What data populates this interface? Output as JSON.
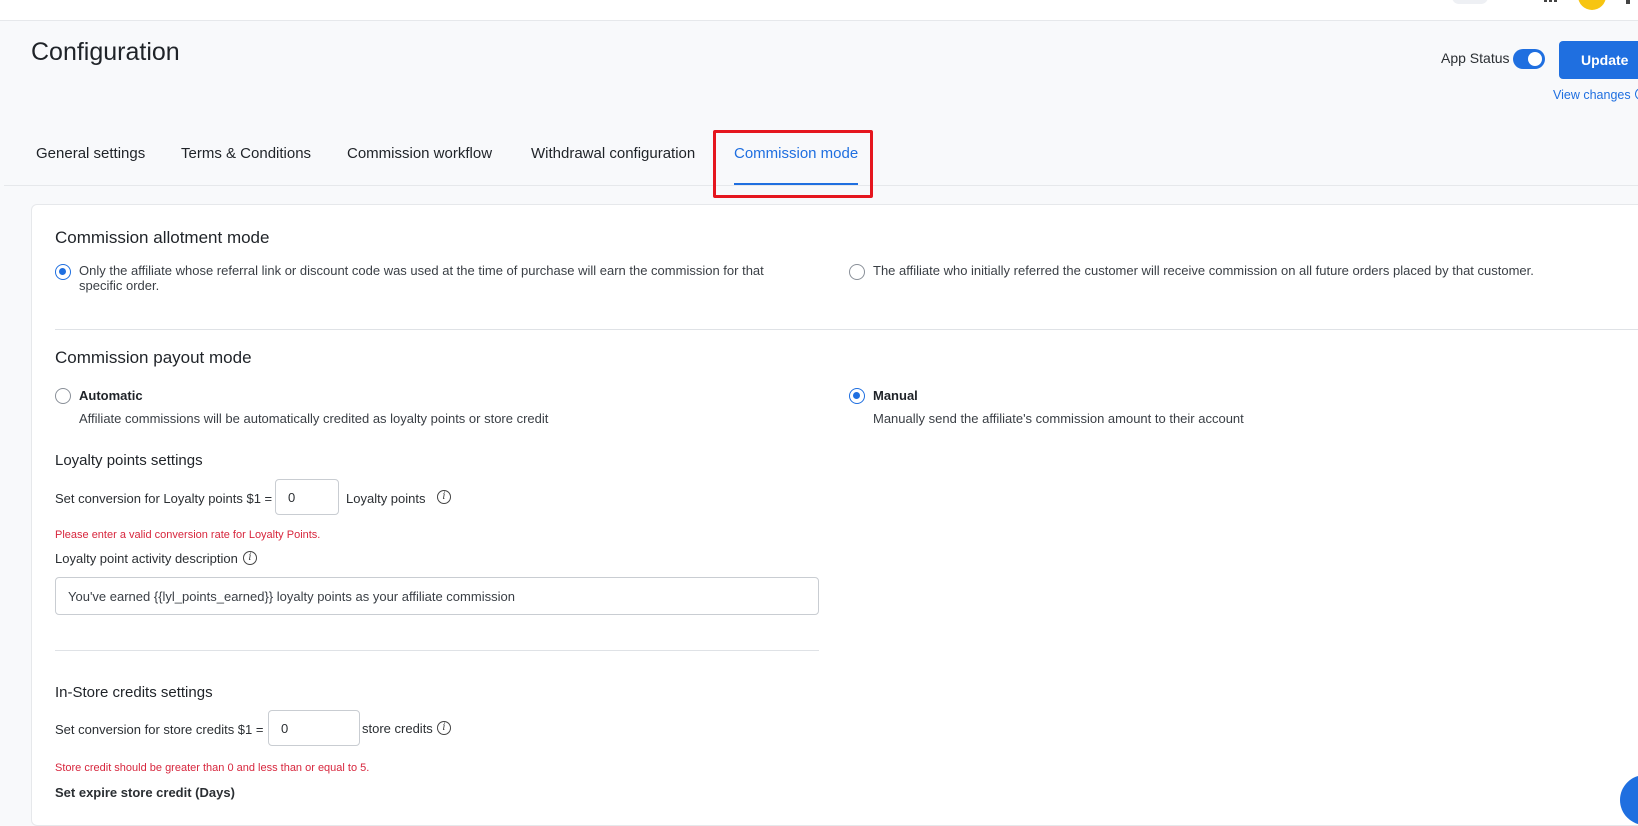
{
  "header": {
    "page_title": "Configuration",
    "app_status_label": "App Status",
    "app_status_on": true,
    "update_label": "Update",
    "view_changes_label": "View changes"
  },
  "tabs": [
    {
      "label": "General settings",
      "active": false
    },
    {
      "label": "Terms & Conditions",
      "active": false
    },
    {
      "label": "Commission workflow",
      "active": false
    },
    {
      "label": "Withdrawal configuration",
      "active": false
    },
    {
      "label": "Commission mode",
      "active": true
    }
  ],
  "allotment": {
    "title": "Commission allotment mode",
    "options": [
      {
        "text": "Only the affiliate whose referral link or discount code was used at the time of purchase will earn the commission for that specific order.",
        "checked": true
      },
      {
        "text": "The affiliate who initially referred the customer will receive commission on all future orders placed by that customer.",
        "checked": false
      }
    ]
  },
  "payout": {
    "title": "Commission payout mode",
    "options": [
      {
        "label": "Automatic",
        "description": "Affiliate commissions will be automatically credited as loyalty points or store credit",
        "checked": false
      },
      {
        "label": "Manual",
        "description": "Manually send the affiliate's commission amount to their account",
        "checked": true
      }
    ]
  },
  "loyalty": {
    "title": "Loyalty points settings",
    "conversion_label": "Set conversion for Loyalty points $1 =",
    "conversion_value": "0",
    "unit_label": "Loyalty points",
    "error": "Please enter a valid conversion rate for Loyalty Points.",
    "description_label": "Loyalty point activity description",
    "description_value": "You've earned {{lyl_points_earned}} loyalty points as your affiliate commission"
  },
  "store_credit": {
    "title": "In-Store credits settings",
    "conversion_label": "Set conversion for store credits $1 =",
    "conversion_value": "0",
    "unit_label": "store credits",
    "error": "Store credit should be greater than 0 and less than or equal to 5.",
    "expire_label": "Set expire store credit (Days)"
  },
  "colors": {
    "accent": "#1f6fe0",
    "error": "#d7263d",
    "highlight": "#e5161e",
    "avatar": "#f7c511"
  }
}
